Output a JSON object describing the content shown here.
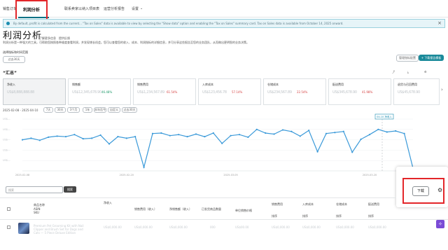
{
  "nav": {
    "items": [
      "销售订单",
      "利润分析",
      "联系卖家以纳入项目表",
      "运营分析报告",
      "设置"
    ],
    "active": "利润分析",
    "settings_chevron": "chevron-down-icon"
  },
  "banner": {
    "text": "By default, profit is calculated from the current... \"Tax on Sales\" data is available to view by selecting the \"Show data\" option and enabling the \"Tax on Sales\" summary card. Tax on Sales data is available from October 14, 2025 onward."
  },
  "page": {
    "title": "利润分析",
    "learn_more": "了解更多信息",
    "feedback": "提供反馈",
    "description": "利润分析是一种强大的工具，可帮助您按照各种维度查看利润，并发现增长机会。您可以查看您的收入、成本、利润指标的详细信息，并可分享这些报告至您的业务团队，从而做出更明智的业务决策。"
  },
  "filters": {
    "section_label": "选择指标和时间范围",
    "date_chip": "过去30天"
  },
  "buttons": {
    "manage_metrics": "管理指标配置",
    "download_report": "+ 下载报告模板"
  },
  "summary": {
    "title": "“汇总”",
    "icons": [
      "share-icon",
      "download-icon",
      "settings-icon"
    ]
  },
  "cards": [
    {
      "label": "净收入",
      "value": "US$8,888,888.88",
      "pct": "",
      "selected": true
    },
    {
      "label": "销售额",
      "value": "US$12,345,678.90",
      "pct": "46.48%",
      "trend": "up",
      "color": "green"
    },
    {
      "label": "销售费用",
      "value": "US$1,234,567.89",
      "pct": "61.54%",
      "trend": "up",
      "color": "red"
    },
    {
      "label": "入库成本",
      "value": "US$123,456.78",
      "pct": "57.14%",
      "trend": "up",
      "color": "red"
    },
    {
      "label": "仓储成本",
      "value": "US$234,567.89",
      "pct": "22.54%",
      "trend": "up",
      "color": "red"
    },
    {
      "label": "配送费用",
      "value": "US$345,678.90",
      "pct": "41.98%",
      "trend": "up",
      "color": "red"
    },
    {
      "label": "退货与召回费用",
      "value": "US$45,678.90",
      "pct": "",
      "color": "red"
    }
  ],
  "range": {
    "dates": "2025-02-08 - 2025-04-10",
    "options": [
      "7天",
      "30天",
      "3个月",
      "1年",
      "本年迄今",
      "自定义",
      "过去30天"
    ]
  },
  "chart_data": {
    "type": "line",
    "x": [
      "2025-02-08",
      "",
      "",
      "",
      "",
      "",
      "",
      "",
      "",
      "",
      "",
      "",
      "2025-02-20",
      "",
      "",
      "",
      "",
      "",
      "",
      "",
      "",
      "",
      "",
      "",
      "2025-03-05",
      "",
      "",
      "",
      "",
      "",
      "",
      "",
      "",
      "",
      "",
      "",
      "",
      "",
      "",
      "",
      "2025-03-20",
      "",
      "",
      "",
      "",
      "",
      "",
      "",
      "",
      "",
      "",
      "",
      "2025-04-01",
      "",
      "",
      "",
      "",
      "2025-04-10"
    ],
    "values": [
      0.6,
      0.63,
      0.59,
      0.65,
      0.67,
      0.66,
      0.7,
      0.62,
      0.63,
      0.69,
      0.52,
      0.66,
      0.63,
      0.66,
      0.07,
      0.72,
      0.73,
      0.68,
      0.7,
      0.66,
      0.71,
      0.66,
      0.73,
      0.53,
      0.68,
      0.7,
      0.65,
      0.8,
      0.73,
      0.71,
      0.79,
      0.76,
      0.67,
      0.78,
      0.37,
      0.72,
      0.74,
      0.76,
      0.36,
      0.61,
      0.7,
      0.8,
      0.75,
      0.77,
      0.72,
      0.05
    ],
    "x_tick_labels": [
      "2025-02-08",
      "2025-02-20",
      "2025-03-05",
      "2025-03-20",
      "2025-04-01"
    ],
    "y_tick_labels": [
      "US$---",
      "US$---",
      "US$---",
      "US$---",
      "US$---"
    ],
    "tooltip": "04-10 净收入",
    "color": "#3b9ad9"
  },
  "table": {
    "search_placeholder": "搜索",
    "search_button": "搜索",
    "download": "下载",
    "headers": [
      "商品名称",
      "净收入",
      "销售费用（收入）",
      "净销售额（收入）",
      "已发货商品数量",
      "单位销售价格",
      "销售费用",
      "入库成本",
      "仓储成本",
      "配送费用"
    ],
    "subheaders": [
      "ASIN",
      "SKU"
    ],
    "sort_labels": [
      "排序",
      "排序",
      "排序",
      "排序"
    ],
    "row_text": "Premium Pet Grooming Kit with Nail Clipper and Brush Set for Dogs and Cats — 5 Piece Deluxe Edition",
    "row_values": [
      "US$0,000.00",
      "US$0,000.00",
      "US$0,000.00",
      "000",
      "US$00.00",
      "US$0,000.00",
      "US$0,000.00",
      "US$0,000.00",
      "US$0,000.00"
    ]
  },
  "colors": {
    "accent": "#007185",
    "highlight": "#e3262a",
    "line": "#3b9ad9"
  }
}
